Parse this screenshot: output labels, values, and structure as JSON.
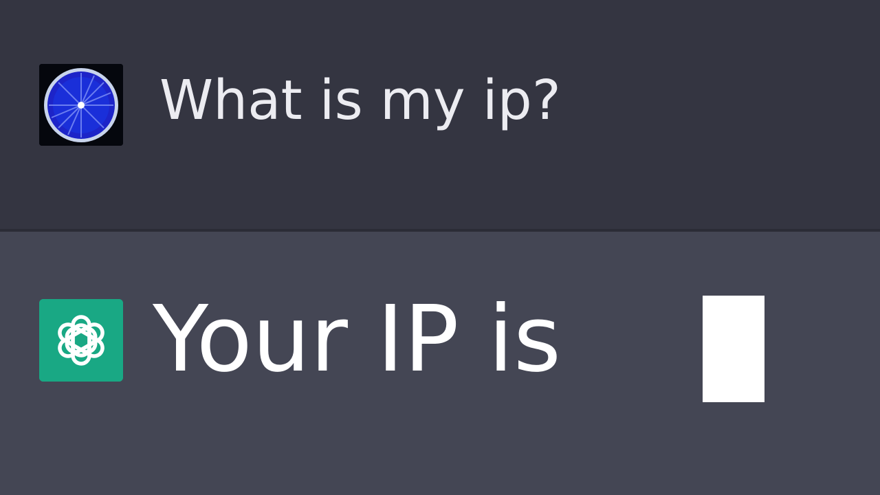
{
  "conversation": {
    "user_message": {
      "avatar_icon": "user-avatar-blue-fruit-slice-icon",
      "text": "What is my ip?"
    },
    "assistant_message": {
      "avatar_icon": "openai-logo-icon",
      "text": "Your IP is",
      "cursor": "block-cursor"
    }
  },
  "colors": {
    "user_row_bg": "#343541",
    "assistant_row_bg": "#444654",
    "assistant_avatar_bg": "#19a884",
    "text": "#ffffff"
  }
}
